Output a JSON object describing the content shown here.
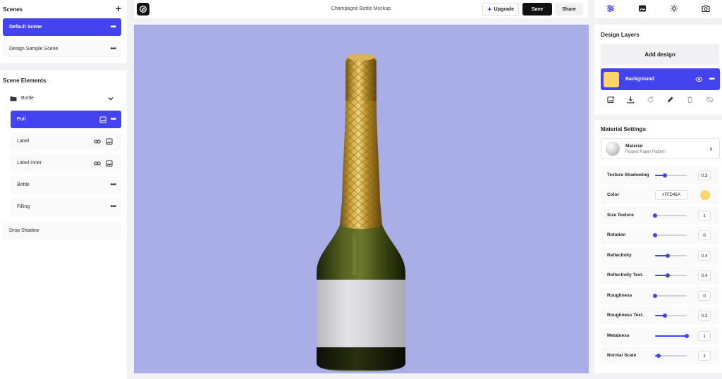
{
  "scenes": {
    "title": "Scenes",
    "add_symbol": "+",
    "items": [
      {
        "label": "Default Scene",
        "more": "•••"
      },
      {
        "label": "Design Sample Scene",
        "more": "•••"
      }
    ]
  },
  "scene_elements": {
    "title": "Scene Elements",
    "group_label": "Bottle",
    "items": [
      {
        "label": "Foil",
        "more": "•••"
      },
      {
        "label": "Label"
      },
      {
        "label": "Label Inner"
      },
      {
        "label": "Bottle",
        "more": "•••"
      },
      {
        "label": "Filling",
        "more": "•••"
      }
    ],
    "drop_shadow": "Drop Shadow"
  },
  "topbar": {
    "title": "Champagne Bottle Mockup",
    "upgrade_label": "Upgrade",
    "upgrade_icon": "sparkle-icon",
    "save_label": "Save",
    "share_label": "Share"
  },
  "right_tabs": [
    "sliders-icon",
    "image-icon",
    "sun-icon",
    "camera-icon"
  ],
  "design_layers": {
    "title": "Design Layers",
    "add_label": "Add design",
    "layer": {
      "name": "Background",
      "swatch": "#FFD46A"
    }
  },
  "material_settings": {
    "title": "Material Settings",
    "material_name": "Material",
    "material_sub": "Pulped Paper Pattern",
    "settings": [
      {
        "label": "Texture Shadowing",
        "value": "0.3",
        "level": 0.3
      },
      {
        "label": "Color",
        "value": "#FFD46A",
        "color": "#FFD46A"
      },
      {
        "label": "Size Texture",
        "value": "1",
        "level": 0.0
      },
      {
        "label": "Rotation",
        "value": "0",
        "level": 0.0
      },
      {
        "label": "Reflectivity",
        "value": "0.4",
        "level": 0.4
      },
      {
        "label": "Reflectivity Text.",
        "value": "0.4",
        "level": 0.4
      },
      {
        "label": "Roughness",
        "value": "0",
        "level": 0.0
      },
      {
        "label": "Roughness Text.",
        "value": "0.3",
        "level": 0.3
      },
      {
        "label": "Metalness",
        "value": "1",
        "level": 1.0
      },
      {
        "label": "Normal Scale",
        "value": "1",
        "level": 0.1
      }
    ]
  },
  "colors": {
    "accent": "#4343F0",
    "canvas_bg": "#AAAEE6",
    "foil": "#C9A23A",
    "glass": "#3E4A12"
  }
}
